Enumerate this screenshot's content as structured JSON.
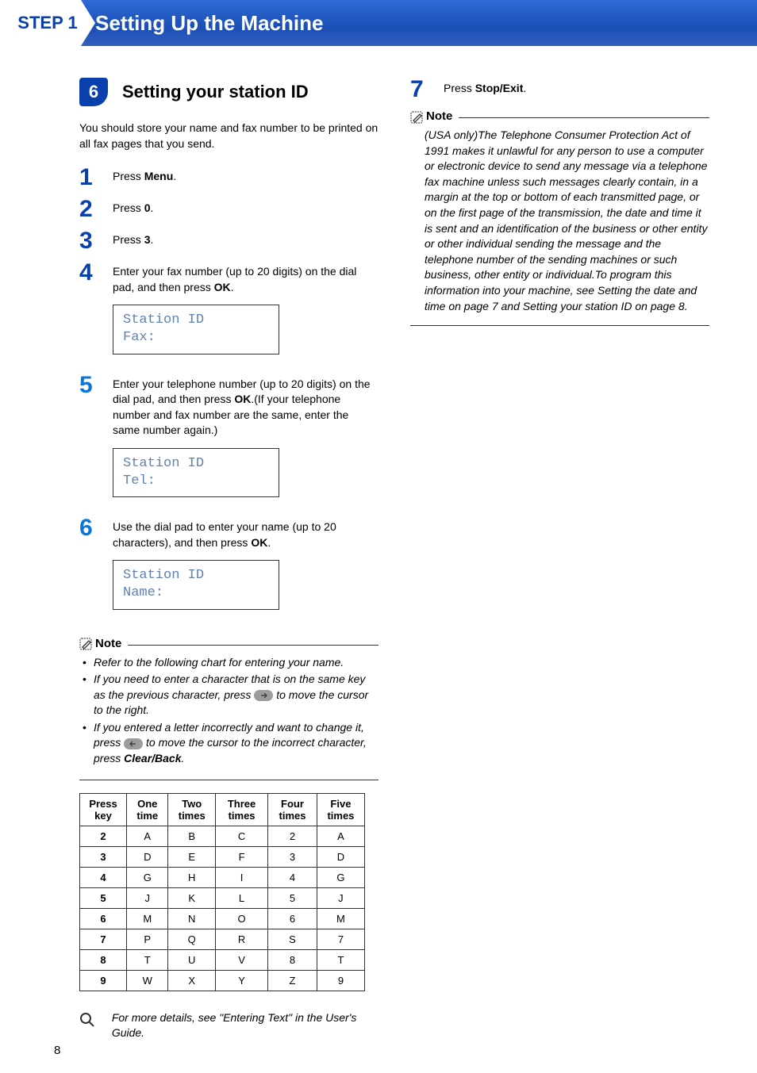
{
  "banner": {
    "step": "STEP 1",
    "title": "Setting Up the Machine"
  },
  "section": {
    "number": "6",
    "title": "Setting your station ID"
  },
  "intro": "You should store your name and fax number to be printed on all fax pages that you send.",
  "steps": {
    "s1": {
      "num": "1",
      "text_pre": "Press ",
      "bold": "Menu",
      "text_post": "."
    },
    "s2": {
      "num": "2",
      "text_pre": "Press ",
      "bold": "0",
      "text_post": "."
    },
    "s3": {
      "num": "3",
      "text_pre": "Press ",
      "bold": "3",
      "text_post": "."
    },
    "s4": {
      "num": "4",
      "text_pre": "Enter your fax number (up to 20 digits) on the dial pad, and then press ",
      "bold": "OK",
      "text_post": "."
    },
    "s5": {
      "num": "5",
      "text_pre": "Enter your telephone number (up to 20 digits) on the dial pad, and then press ",
      "bold": "OK",
      "text_post": ".(If your telephone number and fax number are the same, enter the same number again.)"
    },
    "s6": {
      "num": "6",
      "text_pre": "Use the dial pad to enter your name (up to 20 characters), and then press ",
      "bold": "OK",
      "text_post": "."
    },
    "s7": {
      "num": "7",
      "text_pre": "Press ",
      "bold": "Stop/Exit",
      "text_post": "."
    }
  },
  "lcd": {
    "box1_l1": "Station ID",
    "box1_l2": "Fax:",
    "box2_l1": "Station ID",
    "box2_l2": "Tel:",
    "box3_l1": "Station ID",
    "box3_l2": "Name:"
  },
  "note1": {
    "label": "Note",
    "li1": "Refer to the following chart for entering your name.",
    "li2_pre": "If you need to enter a character that is on the same key as the previous character, press ",
    "li2_post": " to move the cursor to the right.",
    "li3_pre": "If you entered a letter incorrectly and want to change it, press ",
    "li3_mid": " to move the cursor to the incorrect character, press ",
    "li3_bold": "Clear/Back",
    "li3_post": "."
  },
  "chart_data": {
    "type": "table",
    "headers": [
      "Press key",
      "One time",
      "Two times",
      "Three times",
      "Four times",
      "Five times"
    ],
    "rows": [
      [
        "2",
        "A",
        "B",
        "C",
        "2",
        "A"
      ],
      [
        "3",
        "D",
        "E",
        "F",
        "3",
        "D"
      ],
      [
        "4",
        "G",
        "H",
        "I",
        "4",
        "G"
      ],
      [
        "5",
        "J",
        "K",
        "L",
        "5",
        "J"
      ],
      [
        "6",
        "M",
        "N",
        "O",
        "6",
        "M"
      ],
      [
        "7",
        "P",
        "Q",
        "R",
        "S",
        "7"
      ],
      [
        "8",
        "T",
        "U",
        "V",
        "8",
        "T"
      ],
      [
        "9",
        "W",
        "X",
        "Y",
        "Z",
        "9"
      ]
    ]
  },
  "detail": "For more details, see \"Entering Text\" in the User's Guide.",
  "note2": {
    "label": "Note",
    "text": "(USA only)The Telephone Consumer Protection Act of 1991 makes it unlawful for any person to use a computer or electronic device to send any message via a telephone fax machine unless such messages clearly contain, in a margin at the top or bottom of each transmitted page, or on the first page of the transmission, the date and time it is sent and an identification of the business or other entity or other individual sending the message and the telephone number of the sending machines or such business, other entity or individual.To program this information into your machine, see Setting the date and time on page 7 and Setting your station ID on page 8."
  },
  "page_number": "8"
}
